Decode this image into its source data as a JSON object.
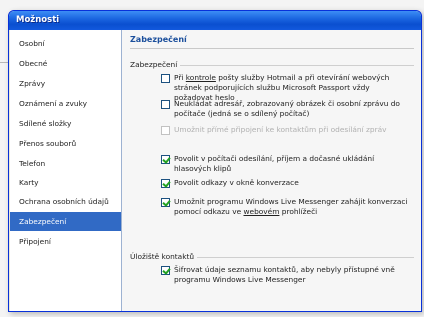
{
  "window": {
    "title": "Možnosti"
  },
  "sidebar": {
    "items": [
      {
        "label": "Osobní",
        "selected": false
      },
      {
        "label": "Obecné",
        "selected": false
      },
      {
        "label": "Zprávy",
        "selected": false
      },
      {
        "label": "Oznámení a zvuky",
        "selected": false
      },
      {
        "label": "Sdílené složky",
        "selected": false
      },
      {
        "label": "Přenos souborů",
        "selected": false
      },
      {
        "label": "Telefon",
        "selected": false
      },
      {
        "label": "Karty",
        "selected": false
      },
      {
        "label": "Ochrana osobních údajů",
        "selected": false
      },
      {
        "label": "Zabezpečení",
        "selected": true
      },
      {
        "label": "Připojení",
        "selected": false
      }
    ]
  },
  "main": {
    "section_title": "Zabezpečení",
    "security_group": {
      "label": "Zabezpečení",
      "options": [
        {
          "text_pre": "Při ",
          "text_ul": "kontrole",
          "text_post": " pošty služby Hotmail a při otevírání webových stránek podporujících službu Microsoft Passport vždy požadovat heslo",
          "checked": false,
          "disabled": false
        },
        {
          "text": "Neukládat adresář, zobrazovaný obrázek či osobní zprávu do počítače (jedná se o sdílený počítač)",
          "checked": false,
          "disabled": false
        },
        {
          "text": "Umožnit přímé připojení ke kontaktům při odesílání zpráv",
          "checked": false,
          "disabled": true
        },
        {
          "text": "Povolit v počítači odesílání, příjem a dočasné ukládání hlasových klipů",
          "checked": true,
          "disabled": false
        },
        {
          "text": "Povolit odkazy v okně konverzace",
          "checked": true,
          "disabled": false
        },
        {
          "text_pre": "Umožnit programu Windows Live Messenger zahájit konverzaci pomocí odkazu ve ",
          "text_ul": "webovém",
          "text_post": " prohlížeči",
          "checked": true,
          "disabled": false
        }
      ]
    },
    "contacts_group": {
      "label": "Úložiště kontaktů",
      "options": [
        {
          "text": "Šifrovat údaje seznamu kontaktů, aby nebyly přístupné vně programu Windows Live Messenger",
          "checked": true,
          "disabled": false
        }
      ]
    }
  },
  "colors": {
    "titlebar": "#1b66e0",
    "selection": "#316ac5",
    "section_title": "#1b4f9c",
    "check": "#21a121"
  }
}
